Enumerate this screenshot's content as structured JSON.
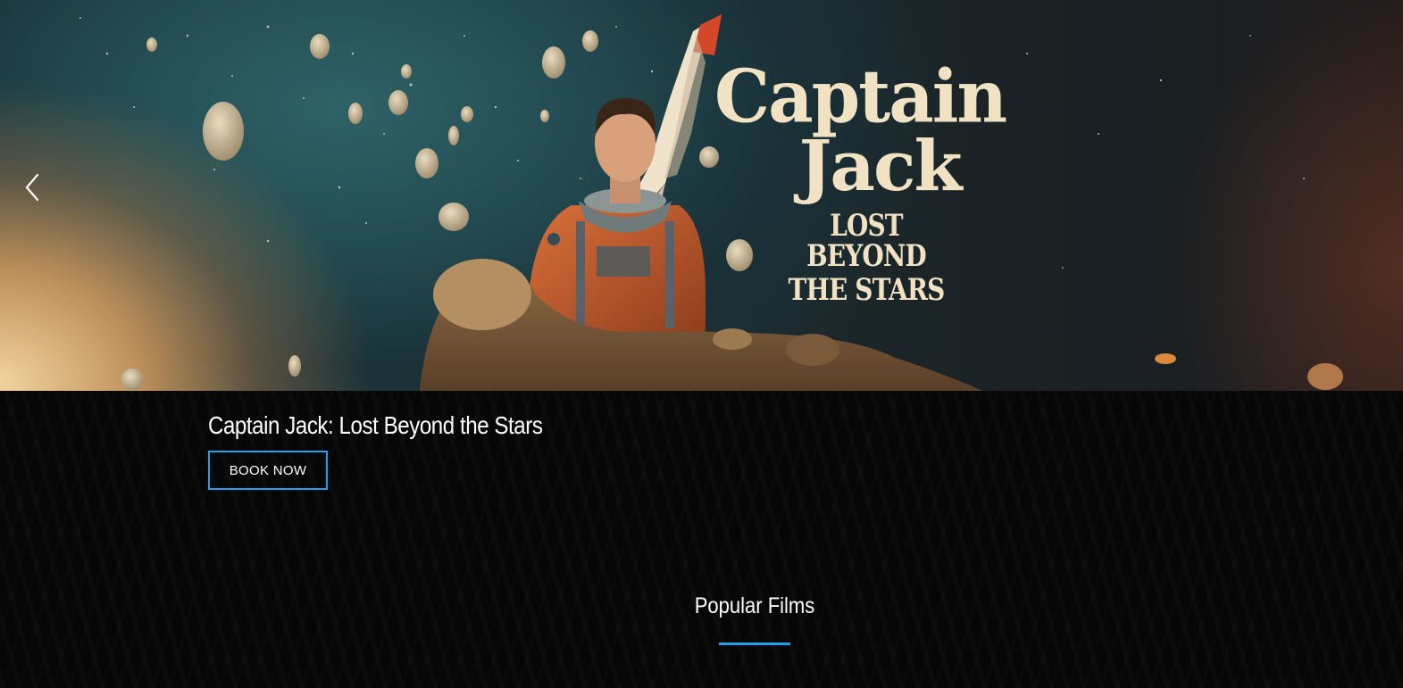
{
  "hero": {
    "poster_title_line1": "Captain",
    "poster_title_line2": "Jack",
    "poster_subtitle_line1": "LOST BEYOND",
    "poster_subtitle_line2": "THE STARS",
    "prev_icon": "chevron-left-icon"
  },
  "caption": {
    "title": "Captain Jack: Lost Beyond the Stars",
    "book_label": "BOOK NOW"
  },
  "section": {
    "heading": "Popular Films"
  },
  "colors": {
    "accent": "#1ea0ea",
    "background": "#060606",
    "poster_text": "#f1e2c3"
  }
}
